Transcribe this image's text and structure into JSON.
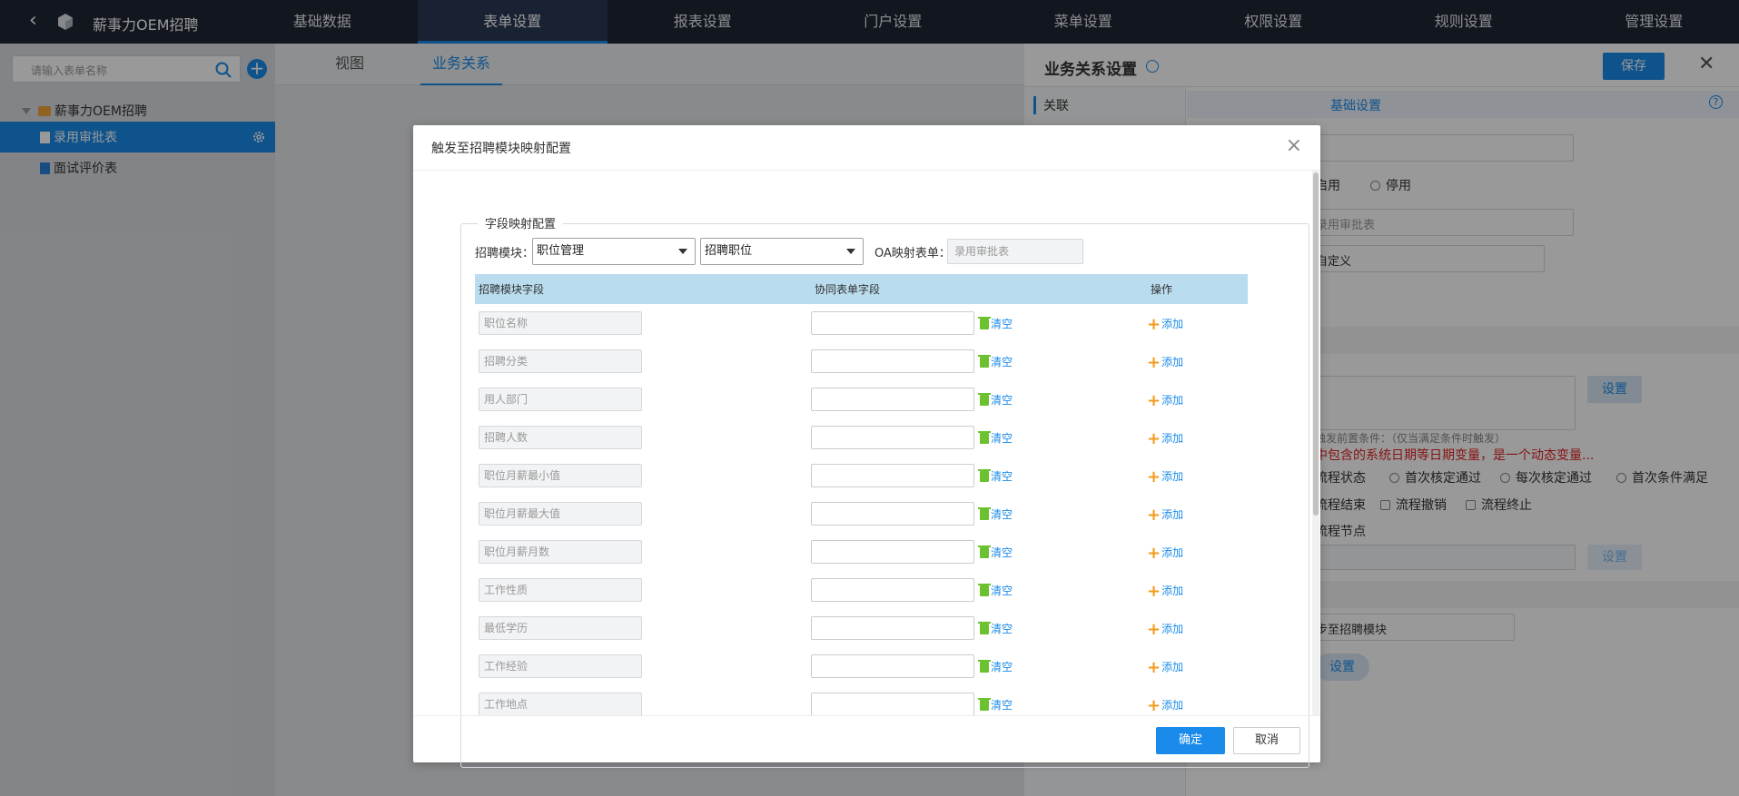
{
  "app": {
    "name": "薪事力OEM招聘"
  },
  "topnav": {
    "items": [
      "基础数据",
      "表单设置",
      "报表设置",
      "门户设置",
      "菜单设置",
      "权限设置",
      "规则设置",
      "管理设置"
    ],
    "active": "表单设置"
  },
  "sidebar": {
    "search_placeholder": "请输入表单名称",
    "tree_root": "薪事力OEM招聘",
    "items": [
      {
        "label": "录用审批表",
        "active": true
      },
      {
        "label": "面试评价表",
        "active": false
      }
    ]
  },
  "main": {
    "tabs": [
      "视图",
      "业务关系"
    ],
    "active_tab": "业务关系"
  },
  "right_panel": {
    "title": "业务关系设置",
    "save_label": "保存",
    "left_nav": "关联",
    "section_title": "基础设置",
    "help_icon": "?",
    "partial": {
      "enable_tail": "启用",
      "disable": "停用",
      "form_value": "录用审批表",
      "custom_value": "自定义",
      "set_label": "设置",
      "cond_hint": "触发前置条件：（仅当满足条件时触发）",
      "warning": "中包含的系统日期等日期变量，是一个动态变量...",
      "process_state": "流程状态",
      "first_approved": "首次核定通过",
      "each_approved": "每次核定通过",
      "first_condition": "首次条件满足",
      "process_end": "流程结束",
      "process_revoke": "流程撤销",
      "process_terminate": "流程终止",
      "process_node": "流程节点",
      "set_label_2": "设置",
      "sync_target": "步至招聘模块",
      "set_label_3": "设置"
    }
  },
  "modal": {
    "title": "触发至招聘模块映射配置",
    "fieldset_legend": "字段映射配置",
    "recruit_module_label": "招聘模块：",
    "recruit_module_value": "职位管理",
    "recruit_sub_value": "招聘职位",
    "oa_form_label": "OA映射表单：",
    "oa_form_placeholder": "录用审批表",
    "columns": [
      "招聘模块字段",
      "协同表单字段",
      "操作"
    ],
    "clear_label": "清空",
    "add_label": "添加",
    "rows": [
      "职位名称",
      "招聘分类",
      "用人部门",
      "招聘人数",
      "职位月薪最小值",
      "职位月薪最大值",
      "职位月薪月数",
      "工作性质",
      "最低学历",
      "工作经验",
      "工作地点"
    ],
    "ok_label": "确定",
    "cancel_label": "取消"
  },
  "colors": {
    "accent": "#1a8bea",
    "topbar": "#1f2533",
    "table_header": "#b9dcee",
    "warning": "#e02020",
    "clear_icon": "#6bc12f",
    "add_icon": "#f39a1e"
  }
}
